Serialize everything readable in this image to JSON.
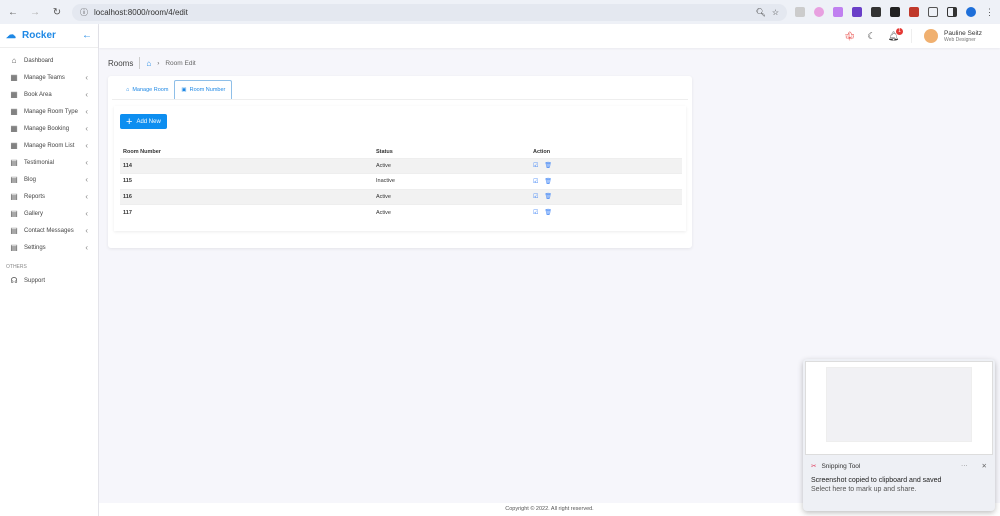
{
  "browser": {
    "url": "localhost:8000/room/4/edit"
  },
  "brand": {
    "name": "Rocker"
  },
  "sidebar": {
    "items": [
      {
        "label": "Dashboard",
        "icon": "home-icon",
        "chevron": false
      },
      {
        "label": "Manage Teams",
        "icon": "grid-icon",
        "chevron": true
      },
      {
        "label": "Book Area",
        "icon": "grid-icon",
        "chevron": true
      },
      {
        "label": "Manage Room Type",
        "icon": "grid-icon",
        "chevron": true
      },
      {
        "label": "Manage Booking",
        "icon": "grid-icon",
        "chevron": true
      },
      {
        "label": "Manage Room List",
        "icon": "grid-icon",
        "chevron": true
      },
      {
        "label": "Testimonial",
        "icon": "doc-icon",
        "chevron": true
      },
      {
        "label": "Blog",
        "icon": "doc-icon",
        "chevron": true
      },
      {
        "label": "Reports",
        "icon": "doc-icon",
        "chevron": true
      },
      {
        "label": "Gallery",
        "icon": "doc-icon",
        "chevron": true
      },
      {
        "label": "Contact Messages",
        "icon": "doc-icon",
        "chevron": true
      },
      {
        "label": "Settings",
        "icon": "doc-icon",
        "chevron": true
      }
    ],
    "section": "OTHERS",
    "support": "Support"
  },
  "topbar": {
    "notifications": "1",
    "user_name": "Pauline Seitz",
    "user_role": "Web Designer"
  },
  "breadcrumb": {
    "title": "Rooms",
    "current": "Room Edit"
  },
  "tabs": [
    {
      "label": "Manage Room"
    },
    {
      "label": "Room Number"
    }
  ],
  "add_button": "Add New",
  "table": {
    "headers": [
      "Room Number",
      "Status",
      "Action"
    ],
    "rows": [
      {
        "number": "114",
        "status": "Active"
      },
      {
        "number": "115",
        "status": "Inactive"
      },
      {
        "number": "116",
        "status": "Active"
      },
      {
        "number": "117",
        "status": "Active"
      }
    ]
  },
  "footer": "Copyright © 2022. All right reserved.",
  "toast": {
    "app": "Snipping Tool",
    "message": "Screenshot copied to clipboard and saved",
    "sub": "Select here to mark up and share."
  },
  "colors": {
    "accent": "#0d8ef0",
    "brand": "#1e88e5"
  }
}
